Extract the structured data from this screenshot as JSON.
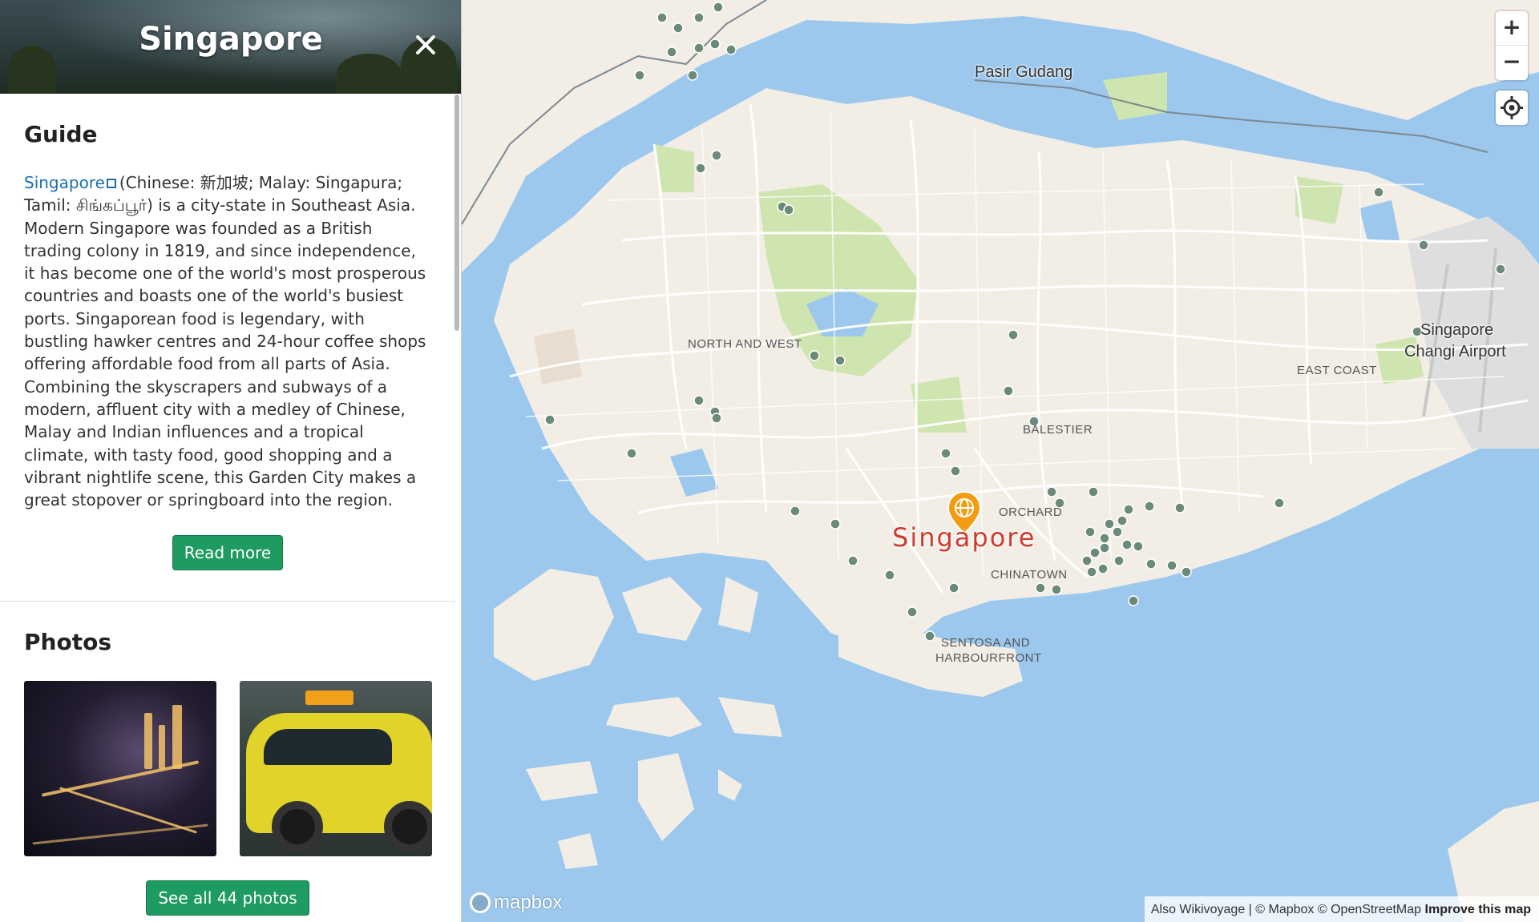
{
  "sidebar": {
    "title": "Singapore",
    "guide": {
      "heading": "Guide",
      "link_text": "Singapore",
      "body": "(Chinese: 新加坡; Malay: Singapura; Tamil: சிங்கப்பூர்) is a city-state in Southeast Asia. Modern Singapore was founded as a British trading colony in 1819, and since independence, it has become one of the world's most prosperous countries and boasts one of the world's busiest ports. Singaporean food is legendary, with bustling hawker centres and 24-hour coffee shops offering affordable food from all parts of Asia. Combining the skyscrapers and subways of a modern, affluent city with a medley of Chinese, Malay and Indian influences and a tropical climate, with tasty food, good shopping and a vibrant nightlife scene, this Garden City makes a great stopover or springboard into the region.",
      "read_more": "Read more"
    },
    "photos": {
      "heading": "Photos",
      "see_all": "See all 44 photos"
    }
  },
  "map": {
    "city_label": "Singapore",
    "places": {
      "pasir_gudang": "Pasir Gudang",
      "changi_1": "Singapore",
      "changi_2": "Changi Airport"
    },
    "districts": {
      "north_west": "NORTH AND WEST",
      "east_coast": "EAST COAST",
      "balestier": "BALESTIER",
      "orchard": "ORCHARD",
      "chinatown": "CHINATOWN",
      "sentosa_1": "SENTOSA AND",
      "sentosa_2": "HARBOURFRONT"
    },
    "controls": {
      "zoom_in": "+",
      "zoom_out": "−"
    },
    "attribution": {
      "text": "Also Wikivoyage | © Mapbox © OpenStreetMap",
      "improve": "Improve this map"
    },
    "logo": "mapbox",
    "colors": {
      "water": "#9cc8ee",
      "land": "#f2eee6",
      "park": "#cfe5b0",
      "marker": "#f39c12",
      "poi": "#6b8a7a"
    }
  }
}
